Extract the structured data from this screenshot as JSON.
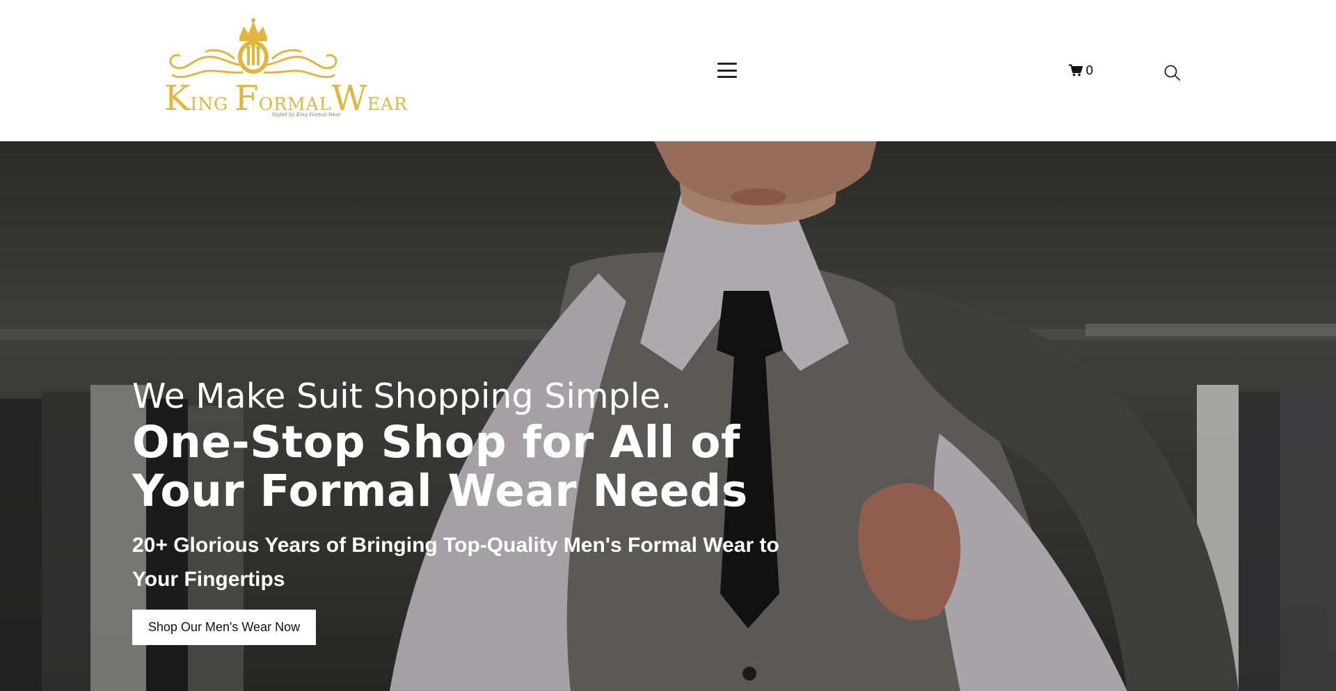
{
  "brand": {
    "name_parts": [
      "K",
      "ING ",
      "F",
      "ORMAL",
      "W",
      "EAR"
    ],
    "tagline": "Styled by King Formal Wear",
    "logo_icon": "crown-crest-icon",
    "color": "#e2b53f"
  },
  "header": {
    "menu_icon": "hamburger-menu-icon",
    "cart": {
      "icon": "shopping-cart-icon",
      "count": "0"
    },
    "search_icon": "search-icon"
  },
  "hero": {
    "eyebrow": "We Make Suit Shopping Simple.",
    "title": "One-Stop Shop for All of Your Formal Wear Needs",
    "subtitle": "20+ Glorious Years of Bringing Top-Quality Men's Formal Wear to Your Fingertips",
    "cta_label": "Shop Our Men's Wear Now",
    "image_subject": "man in grey suit vest and black tie holding jacket over shoulder"
  }
}
